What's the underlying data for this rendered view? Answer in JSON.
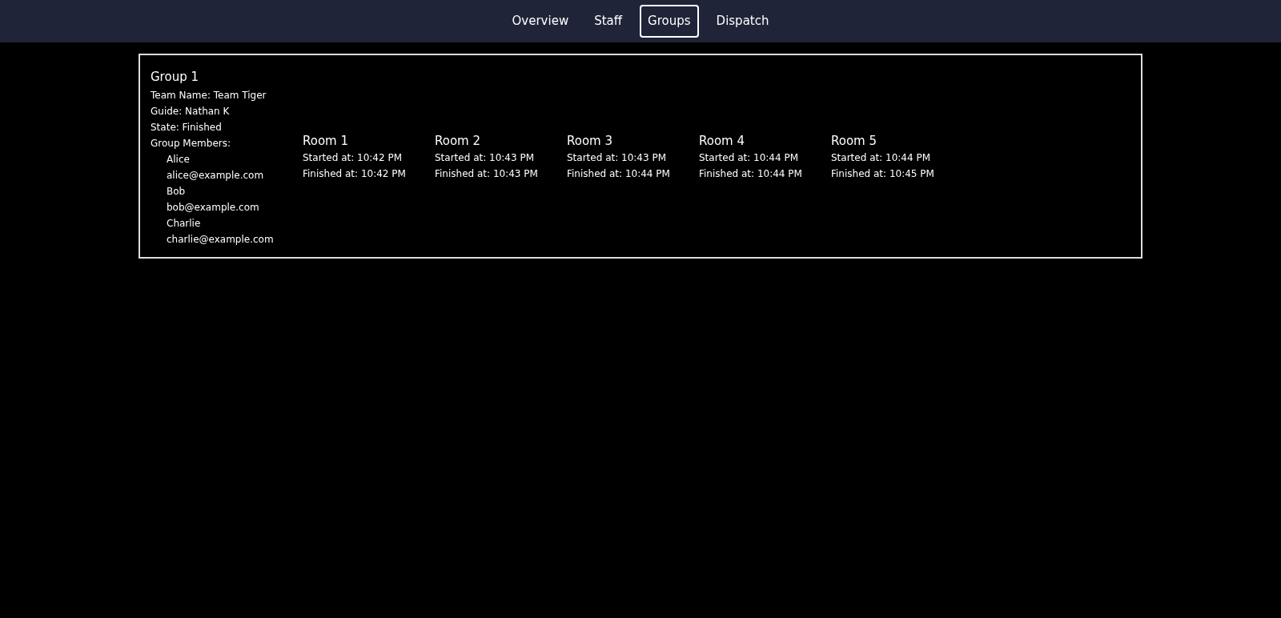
{
  "nav": [
    {
      "label": "Overview",
      "selected": false
    },
    {
      "label": "Staff",
      "selected": false
    },
    {
      "label": "Groups",
      "selected": true
    },
    {
      "label": "Dispatch",
      "selected": false
    }
  ],
  "group": {
    "title": "Group 1",
    "details": [
      "Team Name: Team Tiger",
      "Guide: Nathan K",
      "State: Finished"
    ],
    "members_label": "Group Members:",
    "members": [
      {
        "name": "Alice",
        "email": "alice@example.com"
      },
      {
        "name": "Bob",
        "email": "bob@example.com"
      },
      {
        "name": "Charlie",
        "email": "charlie@example.com"
      }
    ],
    "rooms": [
      {
        "title": "Room 1",
        "started": "Started at: 10:42 PM",
        "finished": "Finished at: 10:42 PM"
      },
      {
        "title": "Room 2",
        "started": "Started at: 10:43 PM",
        "finished": "Finished at: 10:43 PM"
      },
      {
        "title": "Room 3",
        "started": "Started at: 10:43 PM",
        "finished": "Finished at: 10:44 PM"
      },
      {
        "title": "Room 4",
        "started": "Started at: 10:44 PM",
        "finished": "Finished at: 10:44 PM"
      },
      {
        "title": "Room 5",
        "started": "Started at: 10:44 PM",
        "finished": "Finished at: 10:45 PM"
      }
    ]
  }
}
